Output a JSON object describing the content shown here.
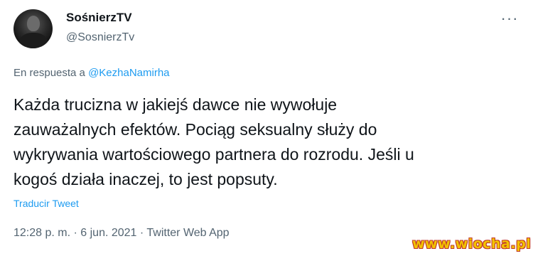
{
  "tweet": {
    "display_name": "SośnierzTV",
    "handle": "@SosnierzTv",
    "more_icon": "more-icon",
    "reply_prefix": "En respuesta a",
    "reply_mention": "@KezhaNamirha",
    "text": "Każda trucizna w jakiejś dawce nie wywołuje\nzauważalnych efektów. Pociąg seksualny służy do\nwykrywania wartościowego partnera do rozrodu. Jeśli u\nkogoś działa inaczej, to jest popsuty.",
    "translate_label": "Traducir Tweet",
    "meta": "12:28 p. m. · 6 jun. 2021 · Twitter Web App"
  },
  "watermark": "www.wiocha.pl",
  "colors": {
    "text": "#0f1419",
    "secondary": "#536471",
    "link": "#1d9bf0"
  }
}
